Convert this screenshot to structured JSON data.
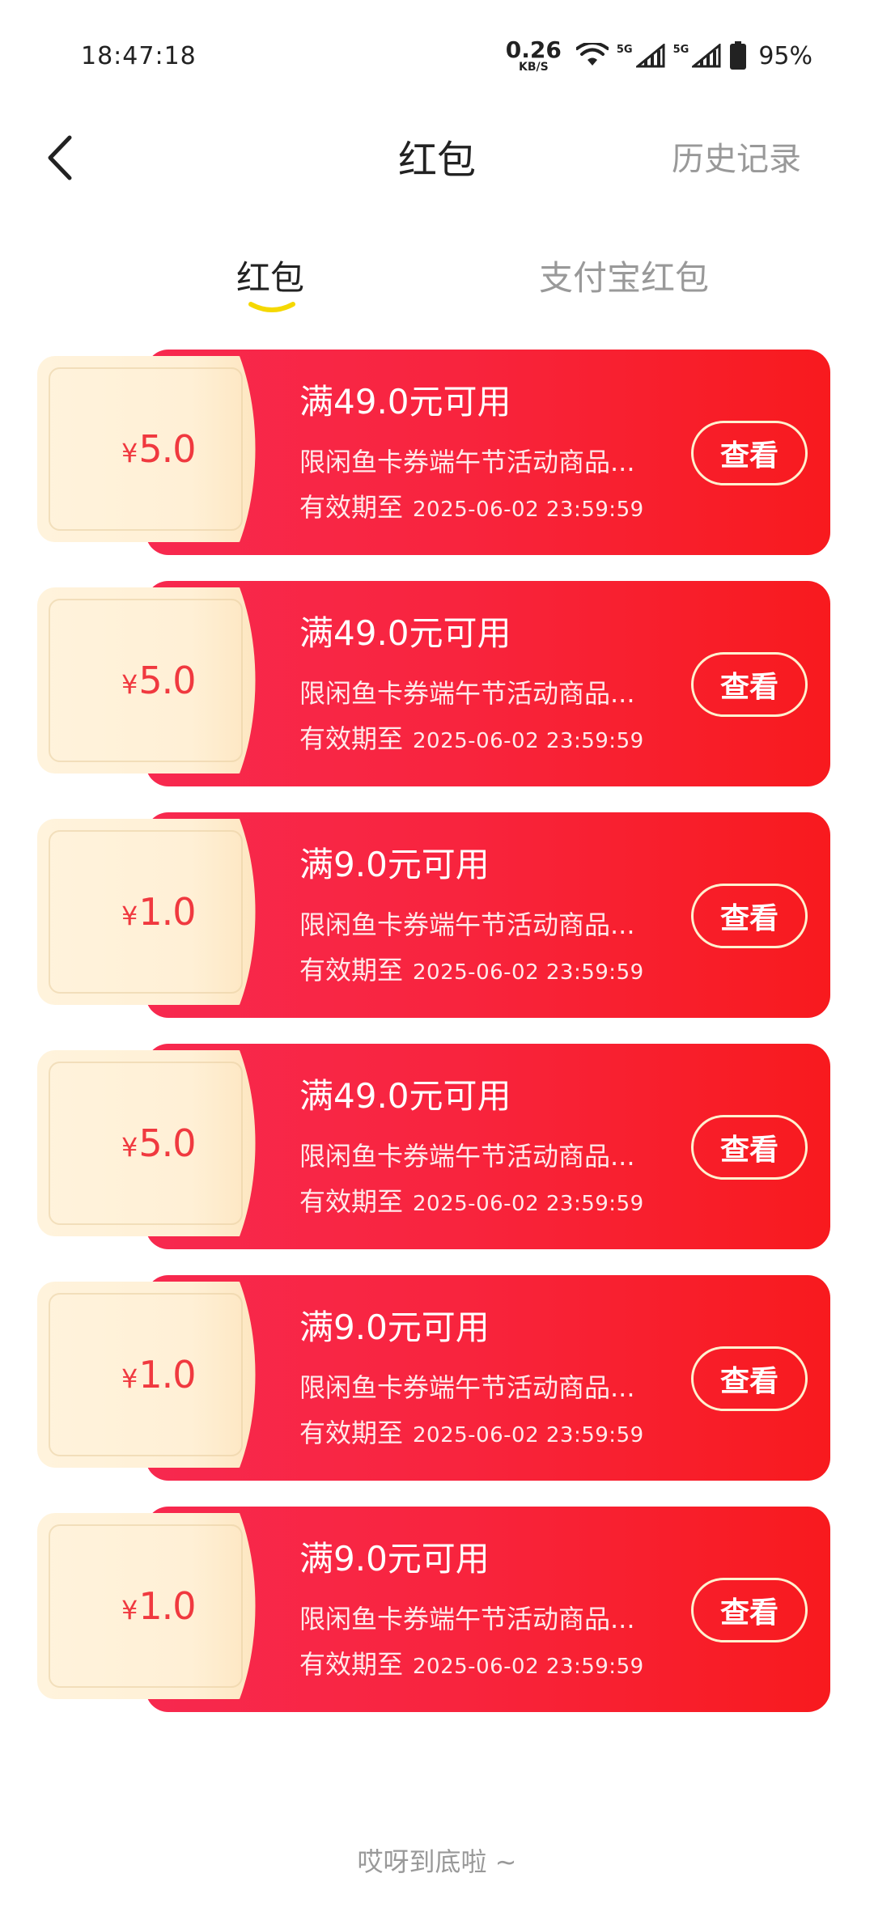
{
  "status_bar": {
    "time": "18:47:18",
    "net_speed": "0.26",
    "net_unit": "KB/S",
    "sig1": "5G",
    "sig2": "5G",
    "battery": "95%"
  },
  "header": {
    "title": "红包",
    "history_label": "历史记录"
  },
  "tabs": [
    {
      "label": "红包",
      "active": true
    },
    {
      "label": "支付宝红包",
      "active": false
    }
  ],
  "coupons": [
    {
      "amount": "5.0",
      "condition": "满49.0元可用",
      "desc": "限闲鱼卡券端午节活动商品...",
      "expiry_label": "有效期至",
      "expiry": "2025-06-02  23:59:59",
      "button": "查看"
    },
    {
      "amount": "5.0",
      "condition": "满49.0元可用",
      "desc": "限闲鱼卡券端午节活动商品...",
      "expiry_label": "有效期至",
      "expiry": "2025-06-02  23:59:59",
      "button": "查看"
    },
    {
      "amount": "1.0",
      "condition": "满9.0元可用",
      "desc": "限闲鱼卡券端午节活动商品...",
      "expiry_label": "有效期至",
      "expiry": "2025-06-02  23:59:59",
      "button": "查看"
    },
    {
      "amount": "5.0",
      "condition": "满49.0元可用",
      "desc": "限闲鱼卡券端午节活动商品...",
      "expiry_label": "有效期至",
      "expiry": "2025-06-02  23:59:59",
      "button": "查看"
    },
    {
      "amount": "1.0",
      "condition": "满9.0元可用",
      "desc": "限闲鱼卡券端午节活动商品...",
      "expiry_label": "有效期至",
      "expiry": "2025-06-02  23:59:59",
      "button": "查看"
    },
    {
      "amount": "1.0",
      "condition": "满9.0元可用",
      "desc": "限闲鱼卡券端午节活动商品...",
      "expiry_label": "有效期至",
      "expiry": "2025-06-02  23:59:59",
      "button": "查看"
    }
  ],
  "currency_symbol": "¥",
  "footer_note": "哎呀到底啦 ~",
  "colors": {
    "accent": "#f8243e",
    "tab_underline": "#f5d800",
    "amount": "#f0393f"
  }
}
